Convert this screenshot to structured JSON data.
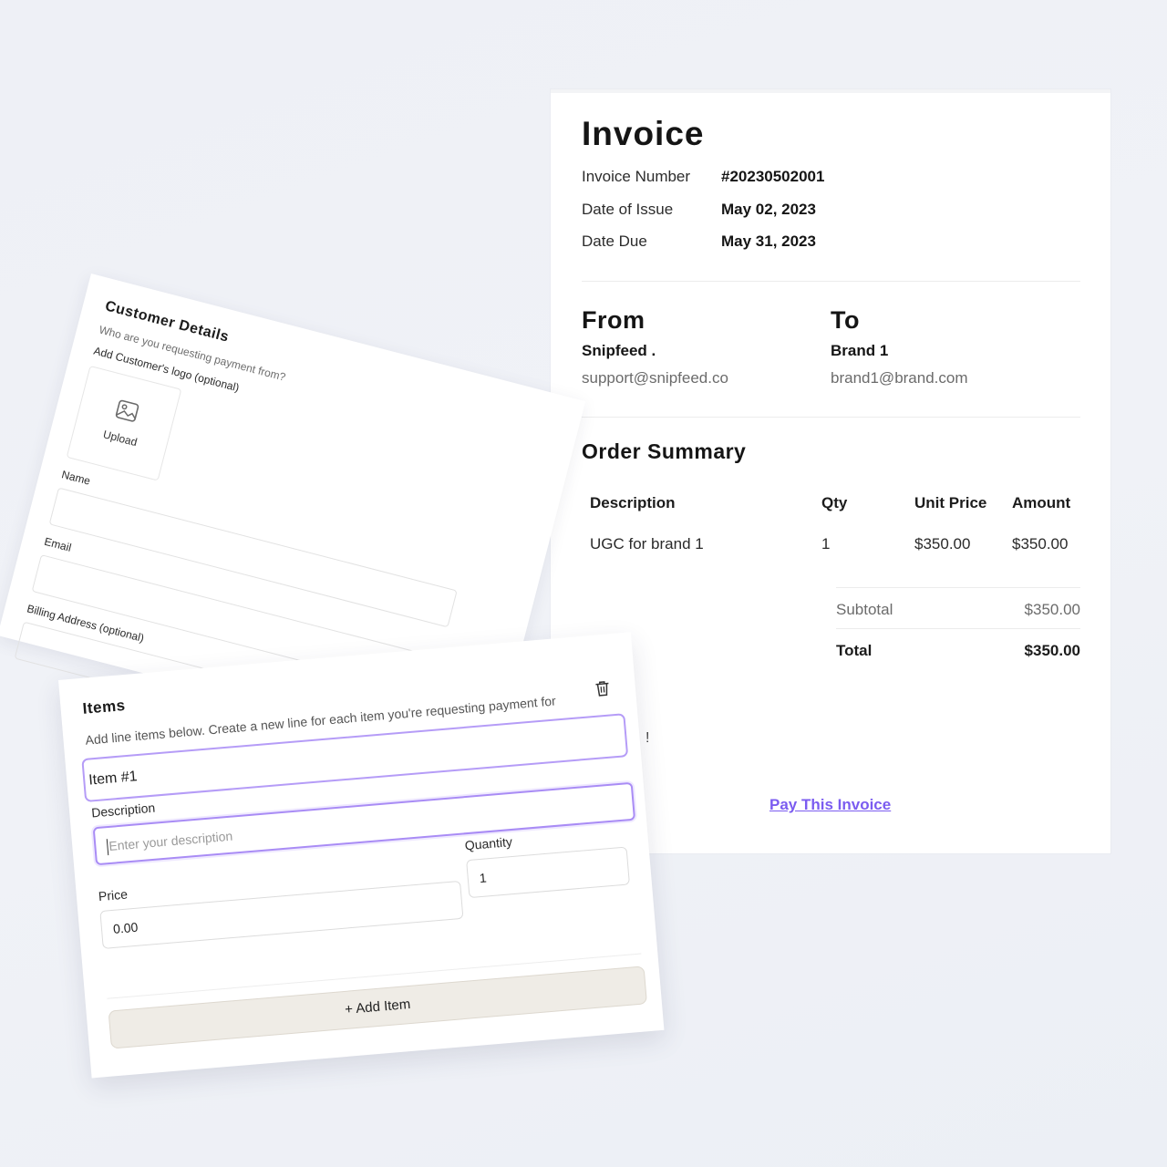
{
  "invoice": {
    "title": "Invoice",
    "meta": [
      {
        "label": "Invoice Number",
        "value": "#20230502001"
      },
      {
        "label": "Date of Issue",
        "value": "May 02, 2023"
      },
      {
        "label": "Date Due",
        "value": "May 31, 2023"
      }
    ],
    "from": {
      "heading": "From",
      "name": "Snipfeed .",
      "email": "support@snipfeed.co"
    },
    "to": {
      "heading": "To",
      "name": "Brand 1",
      "email": "brand1@brand.com"
    },
    "order_summary": {
      "title": "Order Summary",
      "columns": [
        "Description",
        "Qty",
        "Unit Price",
        "Amount"
      ],
      "rows": [
        {
          "description": "UGC for brand 1",
          "qty": "1",
          "unit_price": "$350.00",
          "amount": "$350.00"
        }
      ],
      "subtotal_label": "Subtotal",
      "subtotal_value": "$350.00",
      "total_label": "Total",
      "total_value": "$350.00"
    },
    "peek_text": "!",
    "pay_link": "Pay This Invoice"
  },
  "customer": {
    "title": "Customer Details",
    "subtitle": "Who are you requesting payment from?",
    "logo_label": "Add Customer's logo (optional)",
    "upload_label": "Upload",
    "upload_icon": "image-icon",
    "name_label": "Name",
    "email_label": "Email",
    "billing_label": "Billing Address (optional)"
  },
  "items": {
    "title": "Items",
    "subtitle": "Add line items below. Create a new line for each item you're requesting payment for",
    "delete_icon": "trash-icon",
    "item_heading": "Item #1",
    "description_label": "Description",
    "description_placeholder": "Enter your description",
    "quantity_label": "Quantity",
    "quantity_value": "1",
    "price_label": "Price",
    "price_value": "0.00",
    "add_button": "+ Add Item"
  },
  "colors": {
    "accent": "#7b5cf0",
    "focus_border": "#a98cf5",
    "button_bg": "#efece6"
  }
}
